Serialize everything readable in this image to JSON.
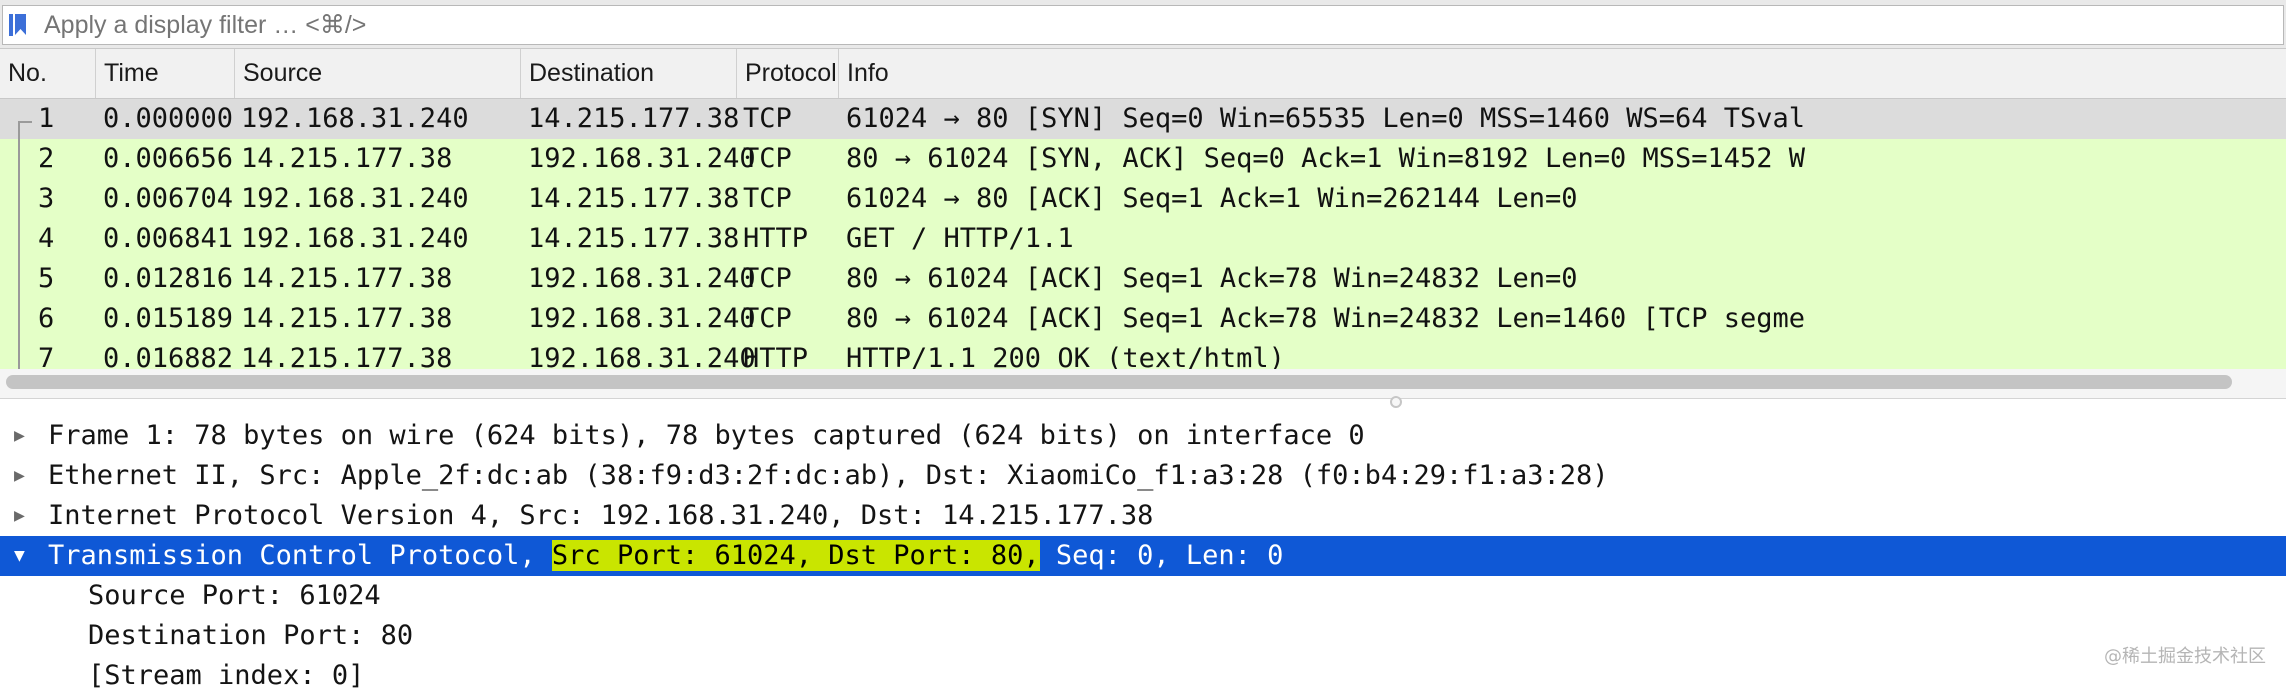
{
  "filter": {
    "placeholder": "Apply a display filter … <⌘/>",
    "icon": "bookmark-icon"
  },
  "columns": [
    "No.",
    "Time",
    "Source",
    "Destination",
    "Protocol",
    "Info"
  ],
  "packets": [
    {
      "no": "1",
      "time": "0.000000",
      "src": "192.168.31.240",
      "dst": "14.215.177.38",
      "proto": "TCP",
      "info": "61024 → 80 [SYN] Seq=0 Win=65535 Len=0 MSS=1460 WS=64 TSval"
    },
    {
      "no": "2",
      "time": "0.006656",
      "src": "14.215.177.38",
      "dst": "192.168.31.240",
      "proto": "TCP",
      "info": "80 → 61024 [SYN, ACK] Seq=0 Ack=1 Win=8192 Len=0 MSS=1452 W"
    },
    {
      "no": "3",
      "time": "0.006704",
      "src": "192.168.31.240",
      "dst": "14.215.177.38",
      "proto": "TCP",
      "info": "61024 → 80 [ACK] Seq=1 Ack=1 Win=262144 Len=0"
    },
    {
      "no": "4",
      "time": "0.006841",
      "src": "192.168.31.240",
      "dst": "14.215.177.38",
      "proto": "HTTP",
      "info": "GET / HTTP/1.1"
    },
    {
      "no": "5",
      "time": "0.012816",
      "src": "14.215.177.38",
      "dst": "192.168.31.240",
      "proto": "TCP",
      "info": "80 → 61024 [ACK] Seq=1 Ack=78 Win=24832 Len=0"
    },
    {
      "no": "6",
      "time": "0.015189",
      "src": "14.215.177.38",
      "dst": "192.168.31.240",
      "proto": "TCP",
      "info": "80 → 61024 [ACK] Seq=1 Ack=78 Win=24832 Len=1460 [TCP segme"
    },
    {
      "no": "7",
      "time": "0.016882",
      "src": "14.215.177.38",
      "dst": "192.168.31.240",
      "proto": "HTTP",
      "info": "HTTP/1.1 200 OK  (text/html)"
    }
  ],
  "details": {
    "frame": "Frame 1: 78 bytes on wire (624 bits), 78 bytes captured (624 bits) on interface 0",
    "ethernet": "Ethernet II, Src: Apple_2f:dc:ab (38:f9:d3:2f:dc:ab), Dst: XiaomiCo_f1:a3:28 (f0:b4:29:f1:a3:28)",
    "ip": "Internet Protocol Version 4, Src: 192.168.31.240, Dst: 14.215.177.38",
    "tcp_prefix": "Transmission Control Protocol, ",
    "tcp_highlight": "Src Port: 61024, Dst Port: 80,",
    "tcp_suffix": " Seq: 0, Len: 0",
    "children": [
      "Source Port: 61024",
      "Destination Port: 80",
      "[Stream index: 0]"
    ]
  },
  "arrows": {
    "collapsed": "▶",
    "expanded": "▼"
  },
  "watermark": "@稀土掘金技术社区",
  "colors": {
    "tcp_row": "#e4ffc7",
    "selected_row": "#dcdcdc",
    "selection_blue": "#0f58d6",
    "highlight": "#c9e500"
  }
}
